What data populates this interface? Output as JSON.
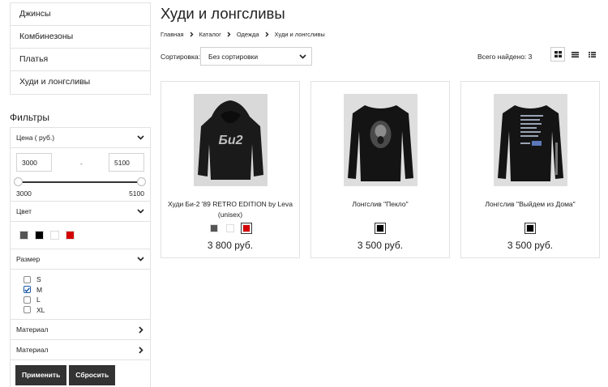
{
  "sidebar": {
    "categories": [
      "Джинсы",
      "Комбинезоны",
      "Платья",
      "Худи и лонгсливы"
    ],
    "filters_title": "Фильтры",
    "price": {
      "label": "Цена ( руб.)",
      "min_value": "3000",
      "max_value": "5100",
      "dash": "-",
      "range_min_label": "3000",
      "range_max_label": "5100",
      "range_start_fraction": 0,
      "range_end_fraction": 1
    },
    "color": {
      "label": "Цвет",
      "swatches": [
        "#555555",
        "#000000",
        "#ffffff",
        "#d40000"
      ]
    },
    "size": {
      "label": "Размер",
      "options": [
        {
          "label": "S",
          "checked": false
        },
        {
          "label": "M",
          "checked": true
        },
        {
          "label": "L",
          "checked": false
        },
        {
          "label": "XL",
          "checked": false
        }
      ]
    },
    "material_1": "Материал",
    "material_2": "Материал",
    "apply_label": "Применить",
    "reset_label": "Сбросить"
  },
  "main": {
    "title": "Худи и лонгсливы",
    "breadcrumbs": [
      "Главная",
      "Каталог",
      "Одежда",
      "Худи и лонгсливы"
    ],
    "sort_label": "Сортировка:",
    "sort_value": "Без сортировки",
    "total": "Всего найдено: 3",
    "view_modes": [
      "grid-icon",
      "list-icon",
      "compact-list-icon"
    ],
    "products": [
      {
        "name": "Худи Би-2 '89 RETRO EDITION by Leva (unisex)",
        "price": "3 800 руб.",
        "image_text": "Би2",
        "swatches": [
          "#555555",
          "#ffffff",
          "#d40000"
        ],
        "selected_swatch": 2
      },
      {
        "name": "Лонгслив \"Пекло\"",
        "price": "3 500 руб.",
        "swatches": [
          "#000000"
        ],
        "selected_swatch": 0
      },
      {
        "name": "Лонгслив \"Выйдем из Дома\"",
        "price": "3 500 руб.",
        "swatches": [
          "#000000"
        ],
        "selected_swatch": 0
      }
    ]
  }
}
